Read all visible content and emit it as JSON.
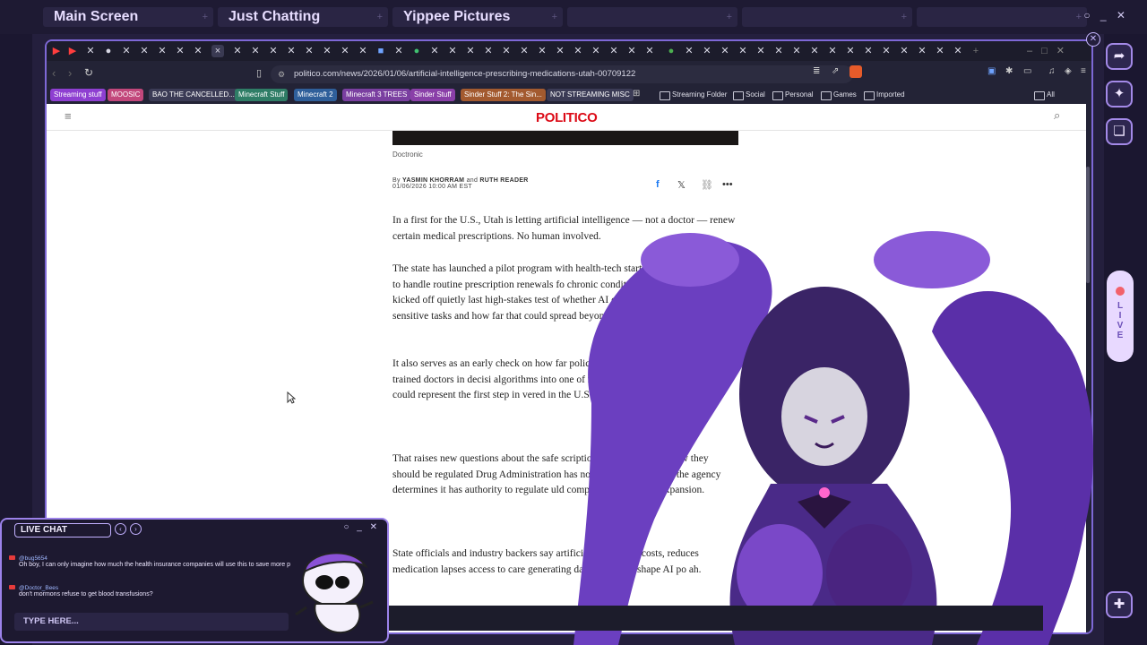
{
  "overlay_tabs": [
    "Main Screen",
    "Just Chatting",
    "Yippee Pictures",
    "",
    "",
    ""
  ],
  "overlay_window_controls": "○ _ ✕",
  "browser": {
    "url": "politico.com/news/2026/01/06/artificial-intelligence-prescribing-medications-utah-00709122",
    "bookmarks": [
      {
        "label": "Streaming stuff",
        "color": "#8e3fd1"
      },
      {
        "label": "MOOSIC",
        "color": "#c2477b"
      },
      {
        "label": "BAO THE CANCELLED...",
        "color": "#3b3b55"
      },
      {
        "label": "Minecraft Stuff",
        "color": "#2f7d66"
      },
      {
        "label": "Minecraft 2",
        "color": "#2f5f9a"
      },
      {
        "label": "Minecraft 3 TREES",
        "color": "#7a3fa0"
      },
      {
        "label": "Sinder Stuff",
        "color": "#8a3fa8"
      },
      {
        "label": "Sinder Stuff 2: The Sin...",
        "color": "#a35a2f"
      },
      {
        "label": "NOT STREAMING MISC",
        "color": "#3b3b55"
      }
    ],
    "bookmark_folders": [
      "Streaming Folder",
      "Social",
      "Personal",
      "Games",
      "Imported"
    ],
    "all_bookmarks": "All Bookmarks"
  },
  "article": {
    "site": "POLITICO",
    "image_credit": "Doctronic",
    "byline_prefix": "By",
    "author1": "YASMIN KHORRAM",
    "and": "and",
    "author2": "RUTH READER",
    "date": "01/06/2026 10:00 AM EST",
    "paragraphs": [
      "In a first for the U.S., Utah is letting artificial intelligence — not a doctor — renew certain medical prescriptions. No human involved.",
      "The state has launched a pilot program with health-tech startu allows an AI system to handle routine prescription renewals fo chronic conditions. The initiative, which kicked off quietly last high-stakes test of whether AI can safely take on one of healt sensitive tasks and how far that could spread beyond one",
      "It also serves as an early check on how far policymak willing to trust AI over trained doctors in decisi algorithms into one of medicine's most fund initiative could represent the first step in                     vered in the U.S.",
      "That raises new questions about the safe               scription refills, including how they should be regulated               Drug Administration has not weighed in on D              If the agency determines it has authority to regulate               uld complicate or slow its expansion.",
      "State officials and industry backers say               artificial inte lowers costs, reduces medication lapses              access to care generating data that could shape AI po                ah."
    ]
  },
  "chat": {
    "title": "LIVE CHAT",
    "controls": "○ _ ✕",
    "messages": [
      {
        "user": "@bug5654",
        "text": "Oh boy, I can only imagine how much the health insurance companies will use this to save more p"
      },
      {
        "user": "@Doctor_Bees",
        "text": "don't mormons refuse to get blood transfusions?"
      }
    ],
    "input_placeholder": "TYPE HERE..."
  },
  "live_label": [
    "L",
    "I",
    "V",
    "E"
  ],
  "colors": {
    "accent": "#9c82ea",
    "politico": "#dc0a16"
  }
}
